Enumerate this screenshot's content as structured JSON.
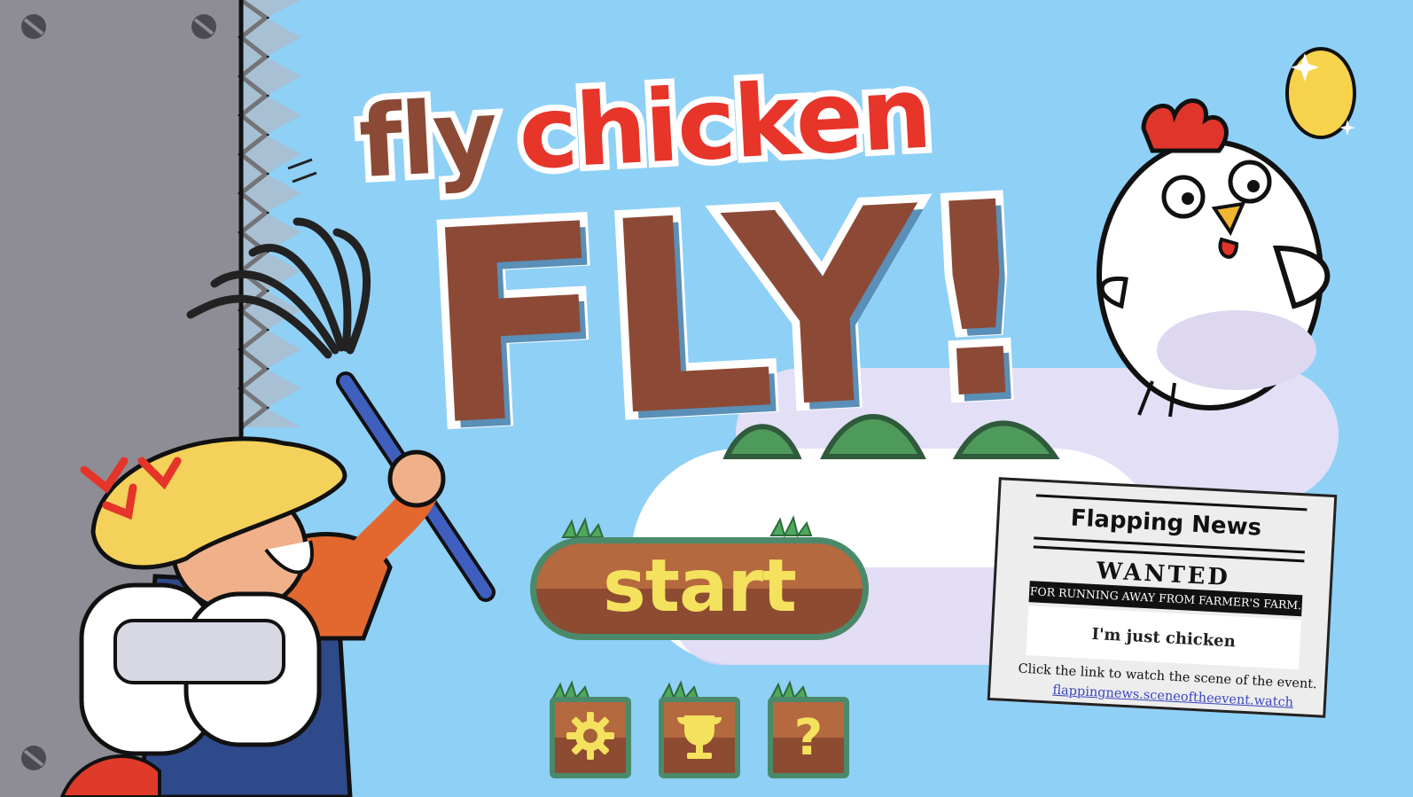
{
  "title": {
    "line1_word1": "fly",
    "line1_word2": "chicken",
    "line2": "FLY!"
  },
  "menu": {
    "start_label": "start",
    "settings_icon": "gear-icon",
    "trophy_icon": "trophy-icon",
    "help_icon": "question-mark-icon",
    "help_glyph": "?"
  },
  "newspaper": {
    "masthead": "Flapping News",
    "headline": "WANTED",
    "subheadline": "FOR RUNNING AWAY FROM FARMER'S FARM.",
    "quote": "I'm just chicken",
    "caption": "Click the link to watch the scene of the event.",
    "link": "flappingnews.sceneoftheevent.watch"
  },
  "colors": {
    "sky": "#8fd0f6",
    "title_brown": "#8c4a36",
    "title_red": "#e7352a",
    "button_brown": "#b5693f",
    "button_text": "#f4e15d",
    "button_border": "#4a8a6a",
    "wall_gray": "#8e8d96"
  }
}
